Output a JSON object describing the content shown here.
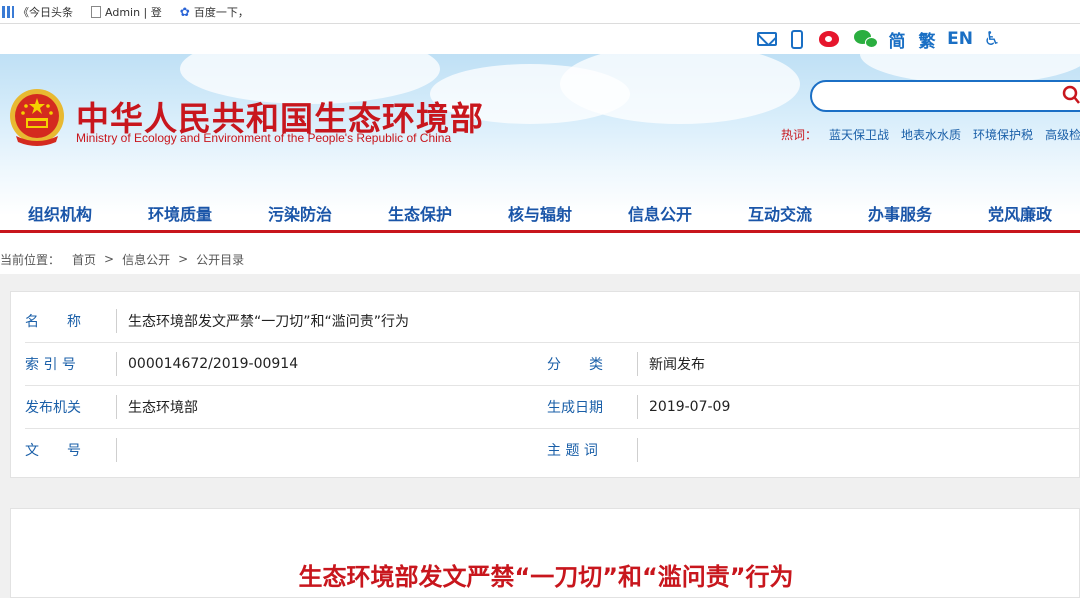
{
  "bookmarks": [
    "《今日头条",
    "Admin | 登",
    "百度一下，"
  ],
  "utility": {
    "simplified": "简",
    "traditional": "繁",
    "english": "EN",
    "accessibility_glyph": "♿"
  },
  "header": {
    "title_cn": "中华人民共和国生态环境部",
    "title_en": "Ministry of Ecology and Environment of the People's Republic of China",
    "search_placeholder": "",
    "hot_label": "热词：",
    "hot_words": [
      "蓝天保卫战",
      "地表水水质",
      "环境保护税",
      "高级检"
    ]
  },
  "nav": [
    "组织机构",
    "环境质量",
    "污染防治",
    "生态保护",
    "核与辐射",
    "信息公开",
    "互动交流",
    "办事服务",
    "党风廉政"
  ],
  "breadcrumb": {
    "prefix": "当前位置：",
    "items": [
      "首页",
      "信息公开",
      "公开目录"
    ],
    "separator": ">"
  },
  "info": {
    "name_label": "名　　称",
    "name_value": "生态环境部发文严禁“一刀切”和“滥问责”行为",
    "index_label": "索 引 号",
    "index_value": "000014672/2019-00914",
    "category_label": "分　　类",
    "category_value": "新闻发布",
    "issuer_label": "发布机关",
    "issuer_value": "生态环境部",
    "date_label": "生成日期",
    "date_value": "2019-07-09",
    "docno_label": "文　　号",
    "docno_value": "",
    "keywords_label": "主 题 词",
    "keywords_value": ""
  },
  "article": {
    "title": "生态环境部发文严禁“一刀切”和“滥问责”行为"
  },
  "colors": {
    "brand_red": "#c8161d",
    "nav_blue": "#1a55a8",
    "link_blue": "#1a5fa8"
  }
}
